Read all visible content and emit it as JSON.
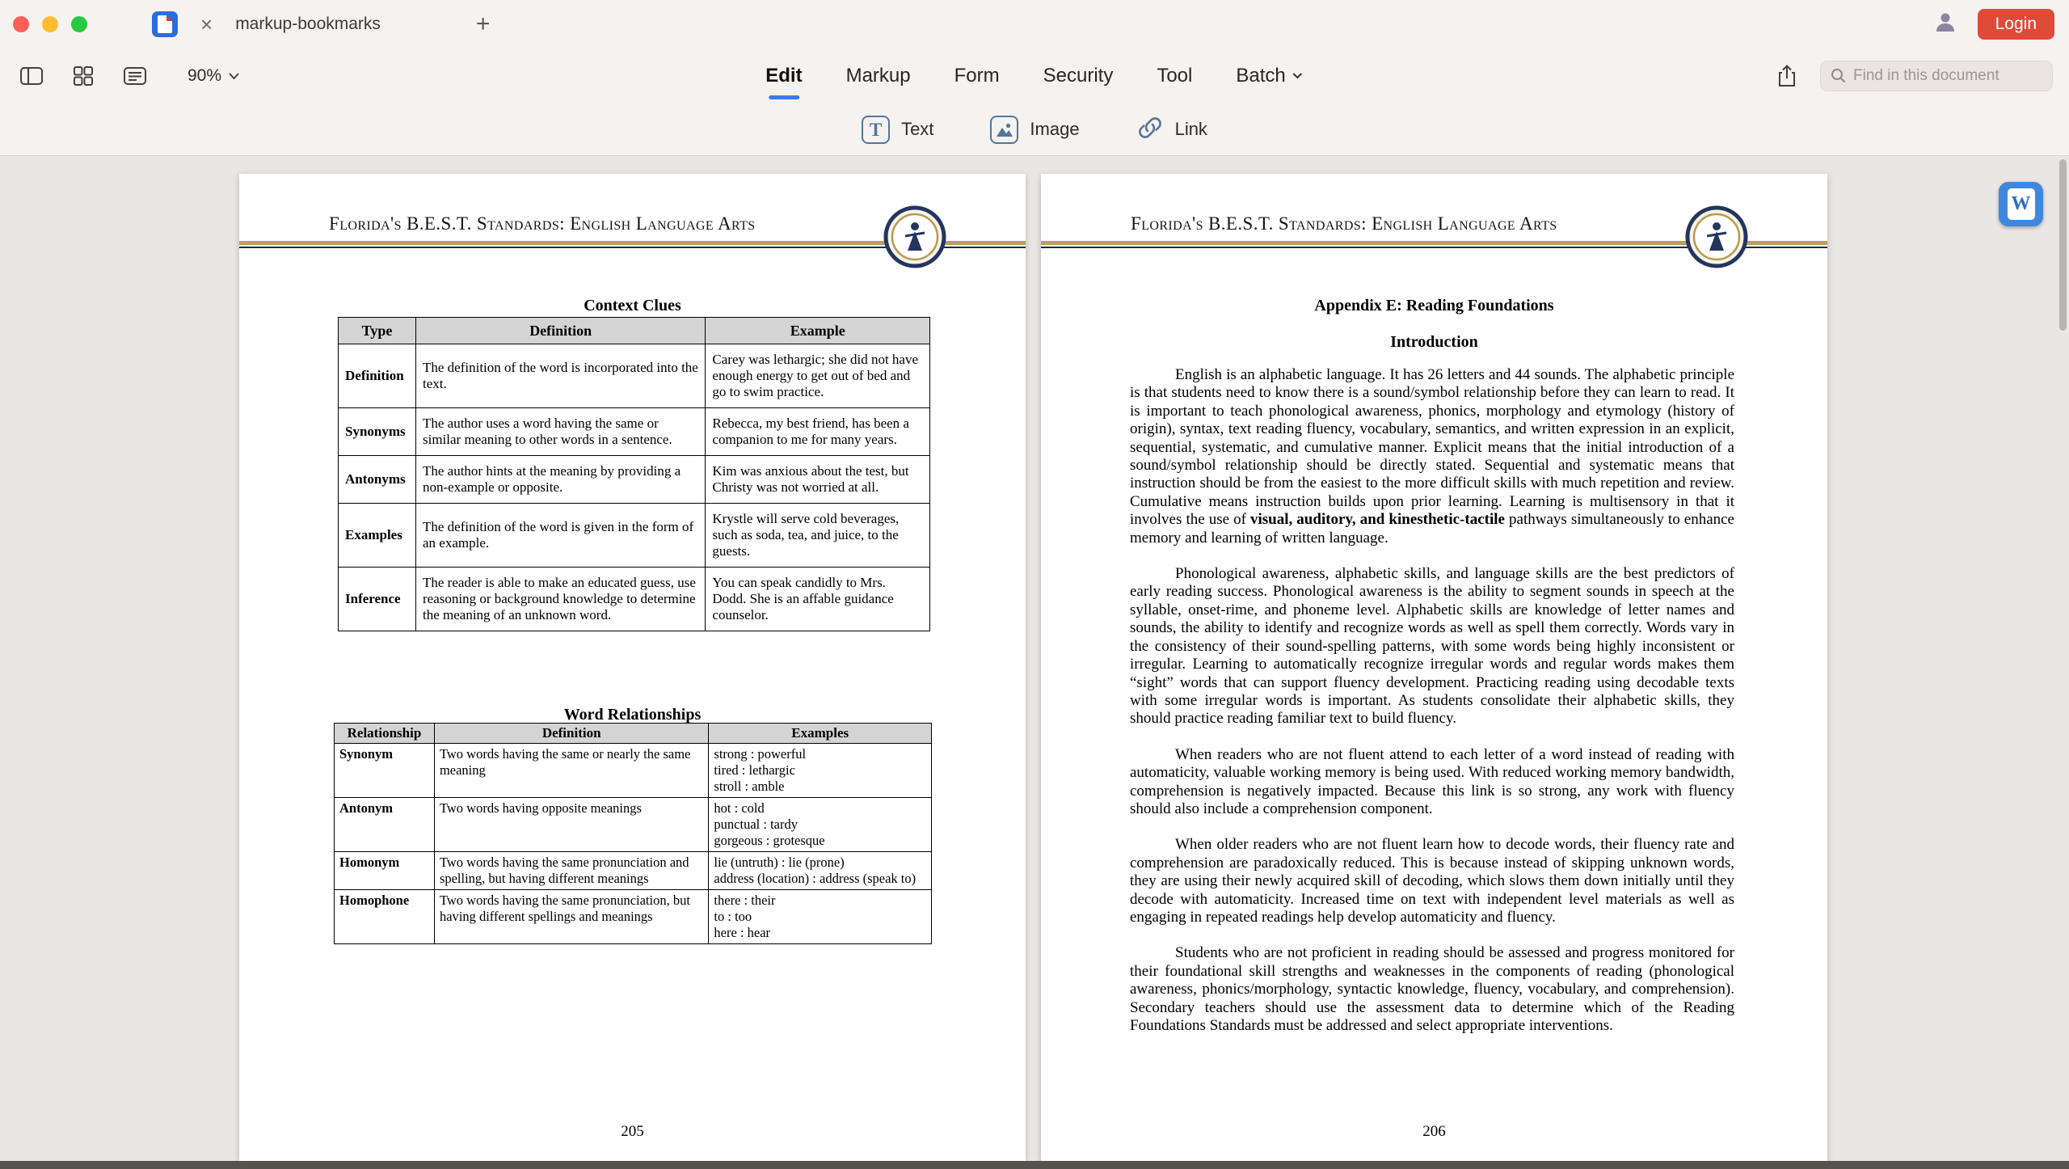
{
  "window": {
    "tab_title": "markup-bookmarks",
    "close_glyph": "×",
    "new_tab_glyph": "+",
    "login_label": "Login"
  },
  "toolbar": {
    "zoom_level": "90%",
    "menus": [
      {
        "label": "Edit",
        "active": true
      },
      {
        "label": "Markup"
      },
      {
        "label": "Form"
      },
      {
        "label": "Security"
      },
      {
        "label": "Tool"
      },
      {
        "label": "Batch",
        "has_chevron": true
      }
    ],
    "search_placeholder": "Find in this document",
    "tools": {
      "text_label": "Text",
      "image_label": "Image",
      "link_label": "Link"
    }
  },
  "document": {
    "left_page": {
      "header": "Florida's B.E.S.T. Standards: English Language Arts",
      "page_number": "205",
      "context_clues": {
        "title": "Context Clues",
        "headers": [
          "Type",
          "Definition",
          "Example"
        ],
        "rows": [
          [
            "Definition",
            "The definition of the word is incorporated into the text.",
            "Carey was lethargic; she did not have enough energy to get out of bed and go to swim practice."
          ],
          [
            "Synonyms",
            "The author uses a word having the same or similar meaning to other words in a sentence.",
            "Rebecca, my best friend, has been a companion to me for many years."
          ],
          [
            "Antonyms",
            "The author hints at the meaning by providing a non-example or opposite.",
            "Kim was anxious about the test, but Christy was not worried at all."
          ],
          [
            "Examples",
            "The definition of the word is given in the form of an example.",
            "Krystle will serve cold beverages, such as soda, tea, and juice, to the guests."
          ],
          [
            "Inference",
            "The reader is able to make an educated guess, use reasoning or background knowledge to determine the meaning of an unknown word.",
            "You can speak candidly to Mrs. Dodd. She is an affable guidance counselor."
          ]
        ]
      },
      "word_relationships": {
        "title": "Word Relationships",
        "headers": [
          "Relationship",
          "Definition",
          "Examples"
        ],
        "rows": [
          [
            "Synonym",
            "Two words having the same or nearly the same meaning",
            [
              "strong : powerful",
              "tired : lethargic",
              "stroll : amble"
            ]
          ],
          [
            "Antonym",
            "Two words having opposite meanings",
            [
              "hot : cold",
              "punctual : tardy",
              "gorgeous : grotesque"
            ]
          ],
          [
            "Homonym",
            "Two words having the same pronunciation and spelling, but having different meanings",
            [
              "lie (untruth) : lie (prone)",
              "address (location) : address (speak to)"
            ]
          ],
          [
            "Homophone",
            "Two words having the same pronunciation, but having different spellings and meanings",
            [
              "there : their",
              "to : too",
              "here : hear"
            ]
          ]
        ]
      }
    },
    "right_page": {
      "header": "Florida's B.E.S.T. Standards: English Language Arts",
      "page_number": "206",
      "title": "Appendix E: Reading Foundations",
      "subtitle": "Introduction",
      "paragraphs": [
        {
          "segments": [
            {
              "text": "English is an alphabetic language. It has 26 letters and 44 sounds. The alphabetic principle is that students need to know there is a sound/symbol relationship before they can learn to read. It is important to teach phonological awareness, phonics, morphology and etymology (history of origin), syntax, text reading fluency, vocabulary, semantics, and written expression in an explicit, sequential, systematic, and cumulative manner. Explicit means that the initial introduction of a sound/symbol relationship should be directly stated. Sequential and systematic means that instruction should be from the easiest to the more difficult skills with much repetition and review. Cumulative means instruction builds upon prior learning. Learning is multisensory in that it involves the use of "
            },
            {
              "text": "visual, auditory, and kinesthetic-tactile",
              "bold": true
            },
            {
              "text": " pathways simultaneously to enhance memory and learning of written language."
            }
          ]
        },
        {
          "segments": [
            {
              "text": "Phonological awareness, alphabetic skills, and language skills are the best predictors of early reading success. Phonological awareness is the ability to segment sounds in speech at the syllable, onset-rime, and phoneme level. Alphabetic skills are knowledge of letter names and sounds, the ability to identify and recognize words as well as spell them correctly. Words vary in the consistency of their sound-spelling patterns, with some words being highly inconsistent or irregular. Learning to automatically recognize irregular words and regular words makes them “sight” words that can support fluency development. Practicing reading using decodable texts with some irregular words is important. As students consolidate their alphabetic skills, they should practice reading familiar text to build fluency."
            }
          ]
        },
        {
          "segments": [
            {
              "text": "When readers who are not fluent attend to each letter of a word instead of reading with automaticity, valuable working memory is being used. With reduced working memory bandwidth, comprehension is negatively impacted. Because this link is so strong, any work with fluency should also include a comprehension component."
            }
          ]
        },
        {
          "segments": [
            {
              "text": "When older readers who are not fluent learn how to decode words, their fluency rate and comprehension are paradoxically reduced. This is because instead of skipping unknown words, they are using their newly acquired skill of decoding, which slows them down initially until they decode with automaticity. Increased time on text with independent level materials as well as engaging in repeated readings help develop automaticity and fluency."
            }
          ]
        },
        {
          "segments": [
            {
              "text": "Students who are not proficient in reading should be assessed and progress monitored for their foundational skill strengths and weaknesses in the components of reading (phonological awareness, phonics/morphology, syntactic knowledge, fluency, vocabulary, and comprehension). Secondary teachers should use the assessment data to determine which of the Reading Foundations Standards must be addressed and select appropriate interventions."
            }
          ]
        }
      ]
    }
  }
}
